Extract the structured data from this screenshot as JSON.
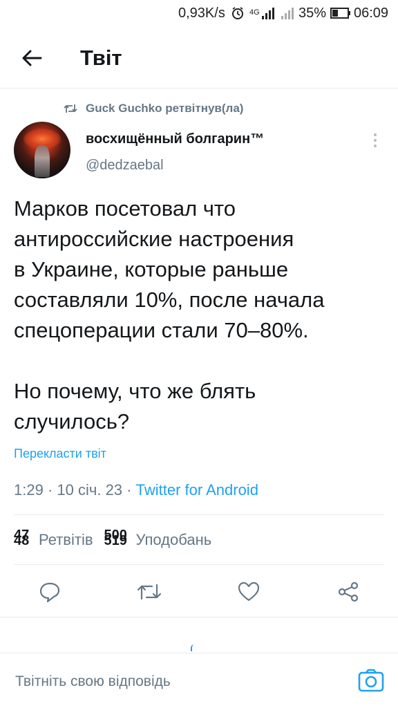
{
  "status_bar": {
    "speed": "0,93K/s",
    "network": "4G",
    "battery_percent": "35%",
    "time": "06:09"
  },
  "header": {
    "back_icon": "arrow-left-icon",
    "title": "Твіт"
  },
  "retweet_context": {
    "icon": "retweet-icon",
    "text": "Guck Guchko ретвітнув(ла)"
  },
  "author": {
    "name": "восхищённый болгарин™",
    "handle": "@dedzaebal"
  },
  "tweet": {
    "text": "Марков посетовал что\nантироссийские настроения\nв Украине, которые раньше\nсоставляли 10%, после начала\nспецоперации стали 70–80%.\n\nНо почему, что же блять\nслучилось?",
    "translate_label": "Перекласти твіт",
    "time": "1:29",
    "date": "10 січ. 23",
    "separator": "·",
    "source": "Twitter for Android"
  },
  "stats": {
    "retweets_old": "47",
    "retweets_new": "48",
    "retweets_label": "Ретвітів",
    "likes_old": "500",
    "likes_new": "519",
    "likes_label": "Уподобань"
  },
  "actions": {
    "reply_icon": "reply-icon",
    "retweet_icon": "retweet-icon",
    "like_icon": "heart-icon",
    "share_icon": "share-icon"
  },
  "reply_bar": {
    "placeholder": "Твітніть свою відповідь",
    "camera_icon": "camera-icon"
  },
  "colors": {
    "accent": "#1da1f2",
    "secondary_text": "#657786",
    "primary_text": "#14171a",
    "divider": "#e6ecf0"
  }
}
